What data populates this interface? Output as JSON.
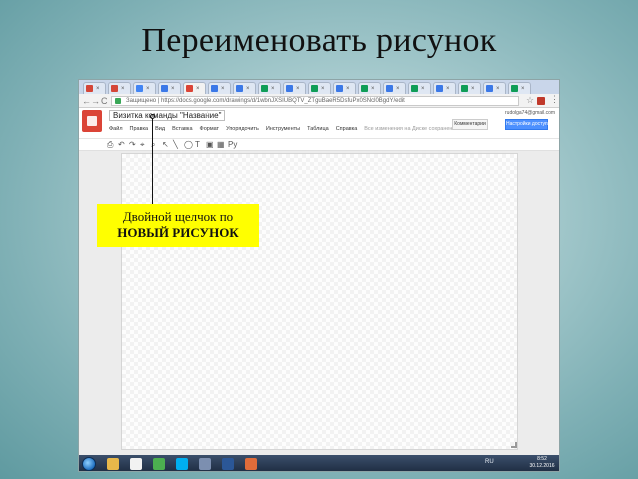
{
  "slide": {
    "title": "Переименовать рисунок"
  },
  "browser": {
    "tabs": [
      {
        "label": "M",
        "icon": "gmail-icon",
        "color": "#d44638"
      },
      {
        "label": "M",
        "icon": "gmail-icon",
        "color": "#d44638"
      },
      {
        "label": "",
        "icon": "drive-icon",
        "color": "#4285f4"
      },
      {
        "label": "",
        "icon": "doc-icon",
        "color": "#3b78e7"
      },
      {
        "label": "",
        "icon": "drawing-icon",
        "color": "#db4437",
        "active": true
      },
      {
        "label": "",
        "icon": "doc-icon",
        "color": "#3b78e7"
      },
      {
        "label": "",
        "icon": "doc-icon",
        "color": "#3b78e7"
      },
      {
        "label": "",
        "icon": "sheet-icon",
        "color": "#0f9d58"
      },
      {
        "label": "",
        "icon": "doc-icon",
        "color": "#3b78e7"
      },
      {
        "label": "",
        "icon": "sheet-icon",
        "color": "#0f9d58"
      },
      {
        "label": "",
        "icon": "doc-icon",
        "color": "#3b78e7"
      },
      {
        "label": "",
        "icon": "sheet-icon",
        "color": "#0f9d58"
      },
      {
        "label": "",
        "icon": "doc-icon",
        "color": "#3b78e7"
      },
      {
        "label": "",
        "icon": "sheet-icon",
        "color": "#0f9d58"
      },
      {
        "label": "",
        "icon": "doc-icon",
        "color": "#3b78e7"
      },
      {
        "label": "",
        "icon": "sheet-icon",
        "color": "#0f9d58"
      },
      {
        "label": "",
        "icon": "doc-icon",
        "color": "#3b78e7"
      },
      {
        "label": "",
        "icon": "sheet-icon",
        "color": "#0f9d58"
      }
    ],
    "back": "←",
    "forward": "→",
    "reload": "C",
    "secure_label": "Защищено",
    "url": "https://docs.google.com/drawings/d/1wbnJXSIUBQTV_ZTguBaeR5DsfuPx0SNcl0BgdY/edit",
    "bookmark": "☆",
    "menu": "⋮"
  },
  "docs": {
    "title": "Визитка команды \"Название\"",
    "star": "☆",
    "menus": [
      "Файл",
      "Правка",
      "Вид",
      "Вставка",
      "Формат",
      "Упорядочить",
      "Инструменты",
      "Таблица",
      "Справка"
    ],
    "save_note": "Все изменения на Диске сохранены",
    "user": "rudolga74@gmail.com",
    "comments_label": "Комментарии",
    "share_label": "Настройки доступа"
  },
  "toolbar": {
    "items": [
      "⎙",
      "↶",
      "↷",
      "⌖",
      "⌕",
      "↖",
      "╲",
      "◯",
      "T",
      "▣",
      "▦",
      "Ру"
    ]
  },
  "taskbar": {
    "apps": [
      {
        "icon": "explorer-icon",
        "color": "#e8b84a"
      },
      {
        "icon": "media-icon",
        "color": "#f2f2f2"
      },
      {
        "icon": "chrome-icon",
        "color": "#4caf50"
      },
      {
        "icon": "skype-icon",
        "color": "#00aff0"
      },
      {
        "icon": "save-icon",
        "color": "#7c8fb0"
      },
      {
        "icon": "word-icon",
        "color": "#2b5797"
      },
      {
        "icon": "paint-icon",
        "color": "#e06c3a"
      }
    ],
    "lang": "RU",
    "time": "8:52",
    "date": "30.12.2016"
  },
  "callout": {
    "line1": "Двойной щелчок по",
    "line2": "НОВЫЙ РИСУНОК"
  }
}
